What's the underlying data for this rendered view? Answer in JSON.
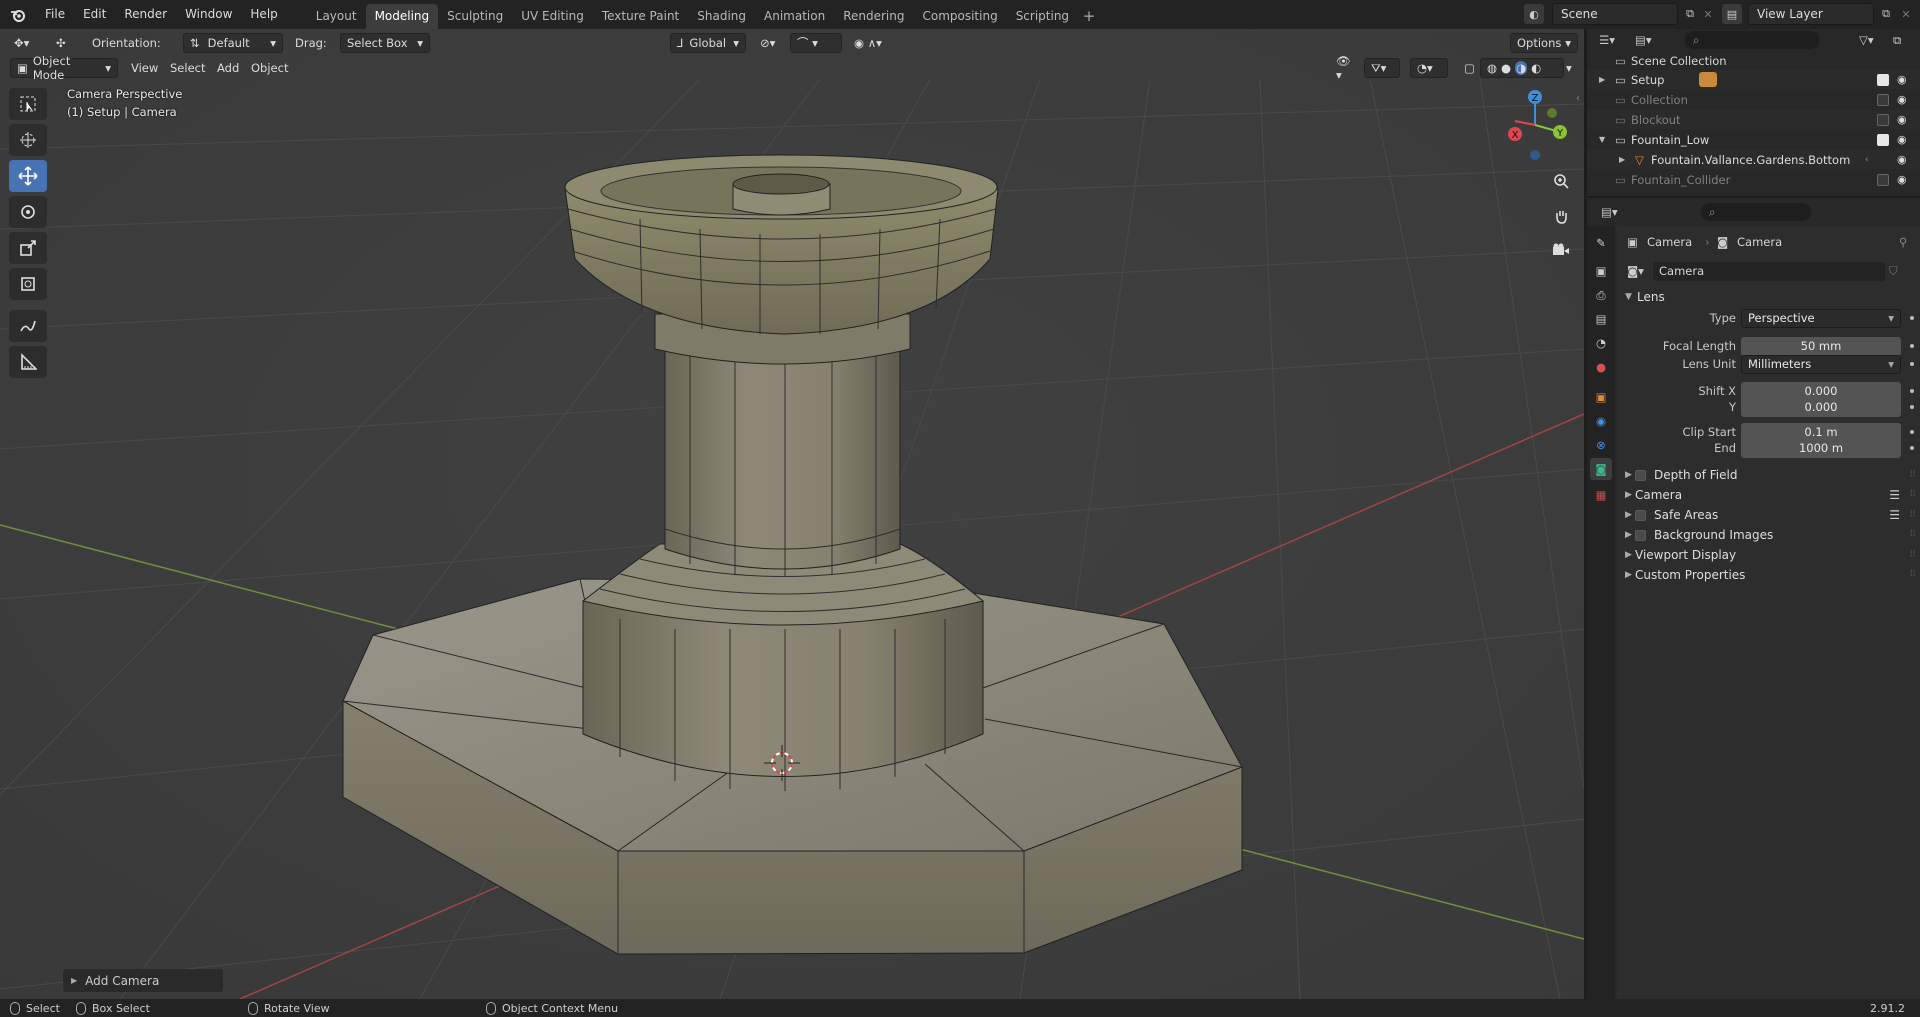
{
  "topbar": {
    "menus": [
      "File",
      "Edit",
      "Render",
      "Window",
      "Help"
    ],
    "workspaces": [
      "Layout",
      "Modeling",
      "Sculpting",
      "UV Editing",
      "Texture Paint",
      "Shading",
      "Animation",
      "Rendering",
      "Compositing",
      "Scripting"
    ],
    "active_workspace": "Modeling",
    "scene": "Scene",
    "view_layer": "View Layer"
  },
  "viewport_header": {
    "orientation_label": "Orientation:",
    "orientation_value": "Default",
    "drag_label": "Drag:",
    "drag_value": "Select Box",
    "transform_orientation": "Global",
    "options": "Options",
    "mode": "Object Mode",
    "menus": [
      "View",
      "Select",
      "Add",
      "Object"
    ]
  },
  "viewport": {
    "camera_label": "Camera Perspective",
    "context_label": "(1) Setup | Camera",
    "gizmo_axes": {
      "x": "X",
      "y": "Y",
      "z": "Z"
    },
    "add_camera_panel": "Add Camera"
  },
  "outliner": {
    "root": "Scene Collection",
    "rows": [
      {
        "label": "Setup",
        "indent": 1,
        "expander": "▶",
        "checked": true,
        "dim": false
      },
      {
        "label": "Collection",
        "indent": 1,
        "expander": "",
        "checked": false,
        "dim": true
      },
      {
        "label": "Blockout",
        "indent": 1,
        "expander": "",
        "checked": false,
        "dim": true
      },
      {
        "label": "Fountain_Low",
        "indent": 1,
        "expander": "▼",
        "checked": true,
        "dim": false
      },
      {
        "label": "Fountain.Vallance.Gardens.Bottom",
        "indent": 2,
        "expander": "▶",
        "checked": null,
        "dim": false
      },
      {
        "label": "Fountain_Collider",
        "indent": 1,
        "expander": "",
        "checked": false,
        "dim": true
      }
    ]
  },
  "properties": {
    "breadcrumb_object": "Camera",
    "breadcrumb_data": "Camera",
    "datablock_name": "Camera",
    "lens_section": "Lens",
    "fields": [
      {
        "label": "Type",
        "value": "Perspective",
        "kind": "select"
      },
      {
        "label": "Focal Length",
        "value": "50 mm",
        "kind": "num"
      },
      {
        "label": "Lens Unit",
        "value": "Millimeters",
        "kind": "select"
      },
      {
        "label": "Shift X",
        "value": "0.000",
        "kind": "num"
      },
      {
        "label": "Y",
        "value": "0.000",
        "kind": "num"
      },
      {
        "label": "Clip Start",
        "value": "0.1 m",
        "kind": "num"
      },
      {
        "label": "End",
        "value": "1000 m",
        "kind": "num"
      }
    ],
    "sections": [
      {
        "label": "Depth of Field",
        "checkbox": true,
        "list": false
      },
      {
        "label": "Camera",
        "checkbox": false,
        "list": true
      },
      {
        "label": "Safe Areas",
        "checkbox": true,
        "list": true
      },
      {
        "label": "Background Images",
        "checkbox": true,
        "list": false
      },
      {
        "label": "Viewport Display",
        "checkbox": false,
        "list": false
      },
      {
        "label": "Custom Properties",
        "checkbox": false,
        "list": false
      }
    ]
  },
  "statusbar": {
    "select": "Select",
    "box_select": "Box Select",
    "rotate_view": "Rotate View",
    "context_menu": "Object Context Menu",
    "version": "2.91.2"
  },
  "colors": {
    "accent": "#4772b3",
    "x_axis": "#e0474d",
    "y_axis": "#8ac539",
    "z_axis": "#3f8fe0",
    "camera_data": "#3eb890"
  }
}
